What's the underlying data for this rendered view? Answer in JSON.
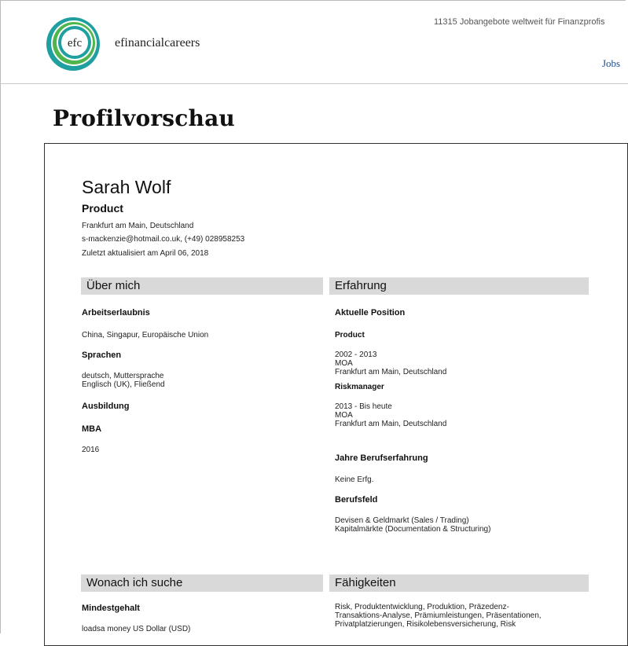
{
  "header": {
    "brand": "efinancialcareers",
    "logo_text": "efc",
    "job_count": "11315 Jobangebote weltweit für Finanzprofis",
    "nav_jobs": "Jobs"
  },
  "page_title": "Profilvorschau",
  "profile": {
    "name": "Sarah Wolf",
    "headline": "Product",
    "location": "Frankfurt am Main, Deutschland",
    "contact": "s-mackenzie@hotmail.co.uk, (+49) 028958253",
    "updated": "Zuletzt aktualisiert am April 06, 2018"
  },
  "about": {
    "title": "Über mich",
    "work_permit_label": "Arbeitserlaubnis",
    "work_permit": "China, Singapur, Europäische Union",
    "languages_label": "Sprachen",
    "languages": "deutsch, Muttersprache\nEnglisch (UK), Fließend",
    "education_label": "Ausbildung",
    "degree_label": "MBA",
    "degree_year": "2016"
  },
  "experience": {
    "title": "Erfahrung",
    "current_label": "Aktuelle Position",
    "position1_title": "Product",
    "position1_details": "2002 - 2013\nMOA\nFrankfurt am Main, Deutschland",
    "position2_title": "Riskmanager",
    "position2_details": "2013 - Bis heute\nMOA\nFrankfurt am Main, Deutschland",
    "years_label": "Jahre Berufserfahrung",
    "years": "Keine Erfg.",
    "field_label": "Berufsfeld",
    "field": "Devisen & Geldmarkt (Sales / Trading)\nKapitalmärkte (Documentation & Structuring)"
  },
  "seeking": {
    "title": "Wonach ich suche",
    "min_salary_label": "Mindestgehalt",
    "min_salary": "loadsa money US Dollar (USD)"
  },
  "skills": {
    "title": "Fähigkeiten",
    "list": "Risk, Produktentwicklung, Produktion, Präzedenz-\nTransaktions-Analyse, Prämiumleistungen, Präsentationen,\nPrivatplatzierungen, Risikolebensversicherung, Risk"
  }
}
